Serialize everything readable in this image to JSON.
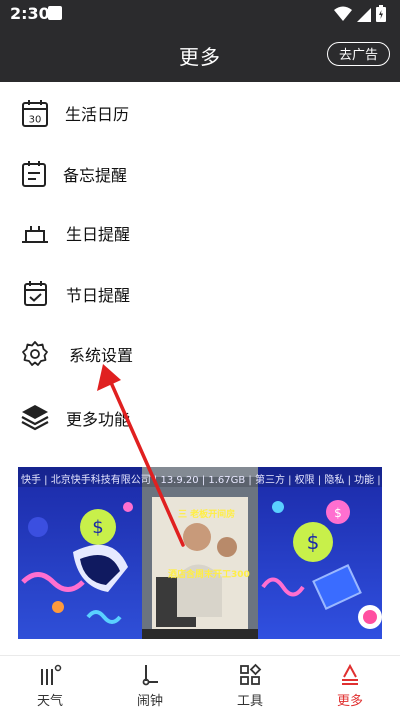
{
  "status_bar": {
    "time": "2:30",
    "icons": [
      "wifi-icon",
      "signal-icon",
      "battery-icon"
    ]
  },
  "header": {
    "title": "更多",
    "ad_button_label": "去广告"
  },
  "menu": {
    "items": [
      {
        "label": "生活日历",
        "icon": "calendar-30-icon",
        "calendar_day": "30"
      },
      {
        "label": "备忘提醒",
        "icon": "memo-icon"
      },
      {
        "label": "生日提醒",
        "icon": "birthday-cake-icon"
      },
      {
        "label": "节日提醒",
        "icon": "holiday-calendar-check-icon"
      },
      {
        "label": "系统设置",
        "icon": "gear-icon"
      },
      {
        "label": "更多功能",
        "icon": "layers-icon"
      }
    ]
  },
  "ad": {
    "caption": "快手 | 北京快手科技有限公司 | 13.9.20 | 1.67GB | 第三方 | 权限 | 隐私 | 功能 | 备案信息",
    "overlay_top": "三 老板开间房",
    "overlay_bottom": "酒店含周末开工300"
  },
  "bottom_nav": {
    "items": [
      {
        "label": "天气",
        "icon": "weather-icon",
        "active": false
      },
      {
        "label": "闹钟",
        "icon": "alarm-icon",
        "active": false
      },
      {
        "label": "工具",
        "icon": "tools-icon",
        "active": false
      },
      {
        "label": "更多",
        "icon": "more-icon",
        "active": true
      }
    ]
  },
  "colors": {
    "header_bg": "#2b2b2d",
    "active_tab": "#e03030",
    "annotation_arrow": "#e02020"
  }
}
